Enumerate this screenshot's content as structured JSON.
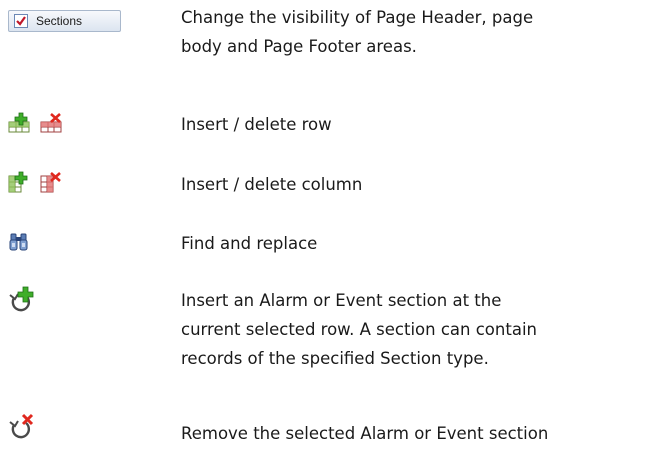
{
  "rows": [
    {
      "icons": [
        "sections-checkbox-icon"
      ],
      "button_label": "Sections",
      "lines": [
        "Change the visibility of Page Header, page",
        "body and Page Footer areas."
      ]
    },
    {
      "icons": [
        "insert-row-icon",
        "delete-row-icon"
      ],
      "lines": [
        "Insert / delete row"
      ]
    },
    {
      "icons": [
        "insert-column-icon",
        "delete-column-icon"
      ],
      "lines": [
        "Insert / delete column"
      ]
    },
    {
      "icons": [
        "binoculars-icon"
      ],
      "lines": [
        "Find and replace"
      ]
    },
    {
      "icons": [
        "insert-section-icon"
      ],
      "lines": [
        "Insert an Alarm or Event section at the",
        "current selected row. A section can contain",
        "records of the specified Section type."
      ]
    },
    {
      "icons": [
        "remove-section-icon"
      ],
      "lines": [
        "Remove the selected Alarm or Event section"
      ]
    }
  ]
}
